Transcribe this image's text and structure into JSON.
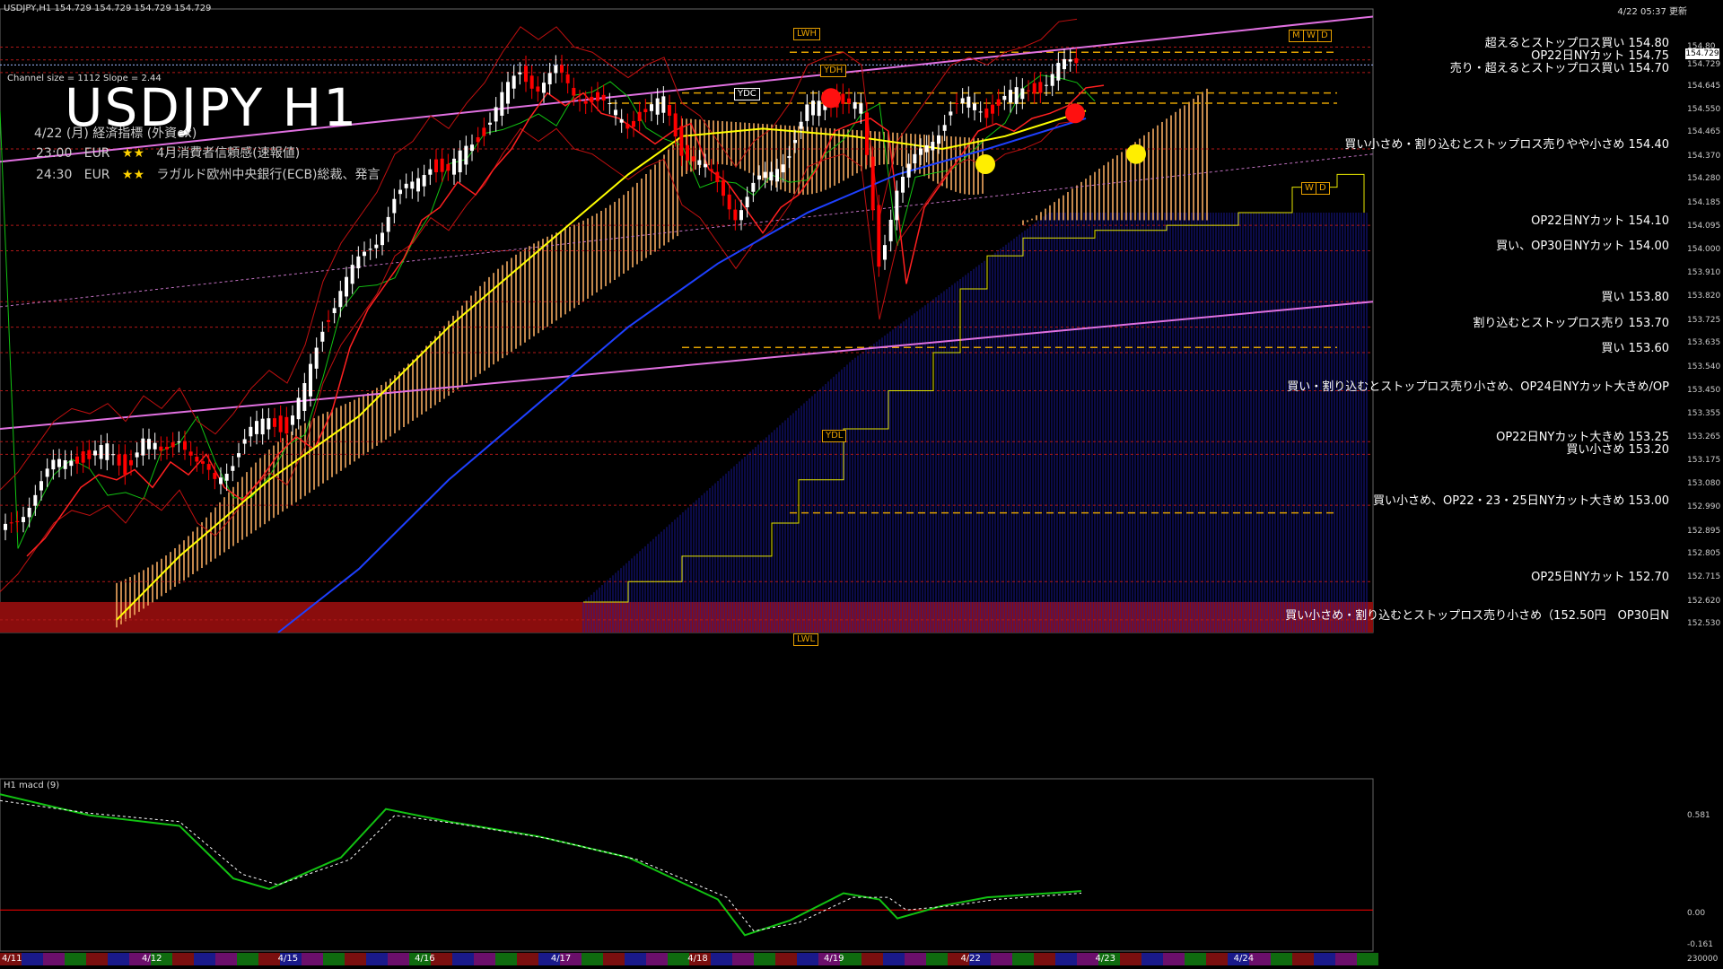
{
  "header": {
    "symbol_line": "USDJPY,H1  154.729 154.729 154.729 154.729",
    "channel_info": "Channel size = 1112 Slope = 2.44",
    "title": "USDJPY H1",
    "updated": "4/22 05:37 更新"
  },
  "events": {
    "title": "4/22 (月) 経済指標 (外資ex)",
    "items": [
      {
        "time": "23:00",
        "ccy": "EUR",
        "stars": "★★",
        "name": "4月消費者信頼感(速報値)"
      },
      {
        "time": "24:30",
        "ccy": "EUR",
        "stars": "★★",
        "name": "ラガルド欧州中央銀行(ECB)総裁、発言"
      }
    ]
  },
  "box_labels": {
    "lwh": "LWH",
    "ydh": "YDH",
    "ydc": "YDC",
    "ydl": "YDL",
    "lwl": "LWL",
    "w": "W",
    "d": "D",
    "m": "M"
  },
  "price_axis": [
    "154.80",
    "154.729",
    "154.645",
    "154.550",
    "154.465",
    "154.370",
    "154.280",
    "154.185",
    "154.095",
    "154.000",
    "153.910",
    "153.820",
    "153.725",
    "153.635",
    "153.540",
    "153.450",
    "153.355",
    "153.265",
    "153.175",
    "153.080",
    "152.990",
    "152.895",
    "152.805",
    "152.715",
    "152.620",
    "152.530"
  ],
  "current_price": "154.729",
  "levels": [
    {
      "price": 154.8,
      "label": "超えるとストップロス買い 154.80"
    },
    {
      "price": 154.75,
      "label": "OP22日NYカット 154.75"
    },
    {
      "price": 154.7,
      "label": "売り・超えるとストップロス買い 154.70"
    },
    {
      "price": 154.4,
      "label": "買い小さめ・割り込むとストップロス売りやや小さめ 154.40"
    },
    {
      "price": 154.1,
      "label": "OP22日NYカット 154.10"
    },
    {
      "price": 154.0,
      "label": "買い、OP30日NYカット 154.00"
    },
    {
      "price": 153.8,
      "label": "買い 153.80"
    },
    {
      "price": 153.7,
      "label": "割り込むとストップロス売り 153.70"
    },
    {
      "price": 153.6,
      "label": "買い 153.60"
    },
    {
      "price": 153.45,
      "label": "買い・割り込むとストップロス売り小さめ、OP24日NYカット大きめ/OP"
    },
    {
      "price": 153.25,
      "label": "OP22日NYカット大きめ 153.25"
    },
    {
      "price": 153.2,
      "label": "買い小さめ 153.20"
    },
    {
      "price": 153.0,
      "label": "買い小さめ、OP22・23・25日NYカット大きめ 153.00"
    },
    {
      "price": 152.7,
      "label": "OP25日NYカット 152.70"
    },
    {
      "price": 152.55,
      "label": "買い小さめ・割り込むとストップロス売り小さめ（152.50円　OP30日N"
    }
  ],
  "macd": {
    "label": "H1 macd (9)",
    "axis": [
      "0.581",
      "0.00",
      "-0.161",
      "230000"
    ]
  },
  "dates": [
    "4/11",
    "4/12",
    "4/15",
    "4/16",
    "4/17",
    "4/18",
    "4/19",
    "4/22",
    "4/23",
    "4/24"
  ],
  "chart_data": {
    "type": "candlestick",
    "title": "USDJPY H1",
    "ylim": [
      152.5,
      154.95
    ],
    "price_path": [
      [
        0,
        152.88
      ],
      [
        20,
        152.95
      ],
      [
        40,
        153.05
      ],
      [
        60,
        153.15
      ],
      [
        80,
        153.2
      ],
      [
        100,
        153.18
      ],
      [
        120,
        153.22
      ],
      [
        140,
        153.15
      ],
      [
        160,
        153.25
      ],
      [
        180,
        153.2
      ],
      [
        200,
        153.28
      ],
      [
        220,
        153.15
      ],
      [
        240,
        153.1
      ],
      [
        260,
        153.18
      ],
      [
        280,
        153.28
      ],
      [
        300,
        153.35
      ],
      [
        320,
        153.3
      ],
      [
        340,
        153.45
      ],
      [
        360,
        153.7
      ],
      [
        380,
        153.85
      ],
      [
        400,
        153.95
      ],
      [
        420,
        154.05
      ],
      [
        440,
        154.2
      ],
      [
        460,
        154.25
      ],
      [
        480,
        154.35
      ],
      [
        500,
        154.3
      ],
      [
        520,
        154.4
      ],
      [
        540,
        154.48
      ],
      [
        560,
        154.6
      ],
      [
        580,
        154.7
      ],
      [
        600,
        154.65
      ],
      [
        620,
        154.7
      ],
      [
        640,
        154.62
      ],
      [
        660,
        154.6
      ],
      [
        680,
        154.55
      ],
      [
        700,
        154.5
      ],
      [
        720,
        154.55
      ],
      [
        740,
        154.58
      ],
      [
        760,
        154.4
      ],
      [
        780,
        154.35
      ],
      [
        800,
        154.25
      ],
      [
        820,
        154.15
      ],
      [
        840,
        154.25
      ],
      [
        860,
        154.3
      ],
      [
        880,
        154.4
      ],
      [
        900,
        154.55
      ],
      [
        920,
        154.58
      ],
      [
        940,
        154.6
      ],
      [
        960,
        154.55
      ],
      [
        980,
        153.95
      ],
      [
        1000,
        154.25
      ],
      [
        1020,
        154.35
      ],
      [
        1040,
        154.45
      ],
      [
        1060,
        154.55
      ],
      [
        1080,
        154.58
      ],
      [
        1100,
        154.55
      ],
      [
        1120,
        154.6
      ],
      [
        1140,
        154.62
      ],
      [
        1160,
        154.65
      ],
      [
        1180,
        154.72
      ],
      [
        1200,
        154.73
      ]
    ],
    "ma_yellow": [
      [
        130,
        152.55
      ],
      [
        200,
        152.8
      ],
      [
        300,
        153.1
      ],
      [
        400,
        153.35
      ],
      [
        500,
        153.7
      ],
      [
        600,
        154.0
      ],
      [
        700,
        154.3
      ],
      [
        760,
        154.45
      ],
      [
        850,
        154.48
      ],
      [
        950,
        154.45
      ],
      [
        1050,
        154.4
      ],
      [
        1120,
        154.45
      ],
      [
        1210,
        154.55
      ]
    ],
    "ma_blue": [
      [
        310,
        152.5
      ],
      [
        400,
        152.75
      ],
      [
        500,
        153.1
      ],
      [
        600,
        153.4
      ],
      [
        700,
        153.7
      ],
      [
        800,
        153.95
      ],
      [
        900,
        154.15
      ],
      [
        1000,
        154.3
      ],
      [
        1100,
        154.4
      ],
      [
        1210,
        154.52
      ]
    ],
    "macd_line": [
      [
        0,
        0.55
      ],
      [
        100,
        0.45
      ],
      [
        200,
        0.4
      ],
      [
        260,
        0.15
      ],
      [
        300,
        0.1
      ],
      [
        380,
        0.25
      ],
      [
        430,
        0.48
      ],
      [
        500,
        0.42
      ],
      [
        600,
        0.35
      ],
      [
        700,
        0.25
      ],
      [
        800,
        0.05
      ],
      [
        830,
        -0.12
      ],
      [
        880,
        -0.05
      ],
      [
        940,
        0.08
      ],
      [
        980,
        0.05
      ],
      [
        1000,
        -0.04
      ],
      [
        1050,
        0.02
      ],
      [
        1100,
        0.06
      ],
      [
        1205,
        0.09
      ]
    ],
    "macd_signal": [
      [
        0,
        0.52
      ],
      [
        100,
        0.46
      ],
      [
        200,
        0.42
      ],
      [
        270,
        0.17
      ],
      [
        310,
        0.12
      ],
      [
        390,
        0.24
      ],
      [
        440,
        0.45
      ],
      [
        510,
        0.41
      ],
      [
        610,
        0.34
      ],
      [
        710,
        0.24
      ],
      [
        810,
        0.06
      ],
      [
        840,
        -0.1
      ],
      [
        890,
        -0.06
      ],
      [
        950,
        0.06
      ],
      [
        990,
        0.06
      ],
      [
        1010,
        0.0
      ],
      [
        1060,
        0.02
      ],
      [
        1110,
        0.05
      ],
      [
        1205,
        0.08
      ]
    ],
    "colors": {
      "up": "#ffffff",
      "down": "#ff0000",
      "ma1": "#ffff00",
      "ma2": "#1e40ff",
      "kumo": "#f2a95f",
      "kumo2": "#1a1aa8",
      "channel": "#e070e0",
      "green": "#12c212",
      "macd": "#12c212",
      "zero": "#ff0000"
    }
  }
}
